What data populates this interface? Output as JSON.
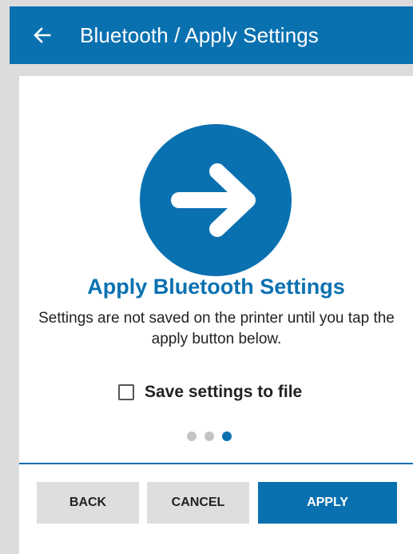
{
  "appbar": {
    "title": "Bluetooth / Apply Settings",
    "back_icon": "arrow-left-icon"
  },
  "hero": {
    "icon": "arrow-right-icon",
    "color": "#0a71b1"
  },
  "content": {
    "heading": "Apply Bluetooth Settings",
    "description": "Settings are not saved on the printer until you tap the apply button below."
  },
  "save_option": {
    "label": "Save settings to file",
    "checked": false
  },
  "pager": {
    "total": 3,
    "current": 3
  },
  "buttons": {
    "back": "BACK",
    "cancel": "CANCEL",
    "apply": "APPLY"
  },
  "colors": {
    "accent": "#0a71b1",
    "background": "#dcdcdc",
    "button_gray": "#dedede"
  }
}
